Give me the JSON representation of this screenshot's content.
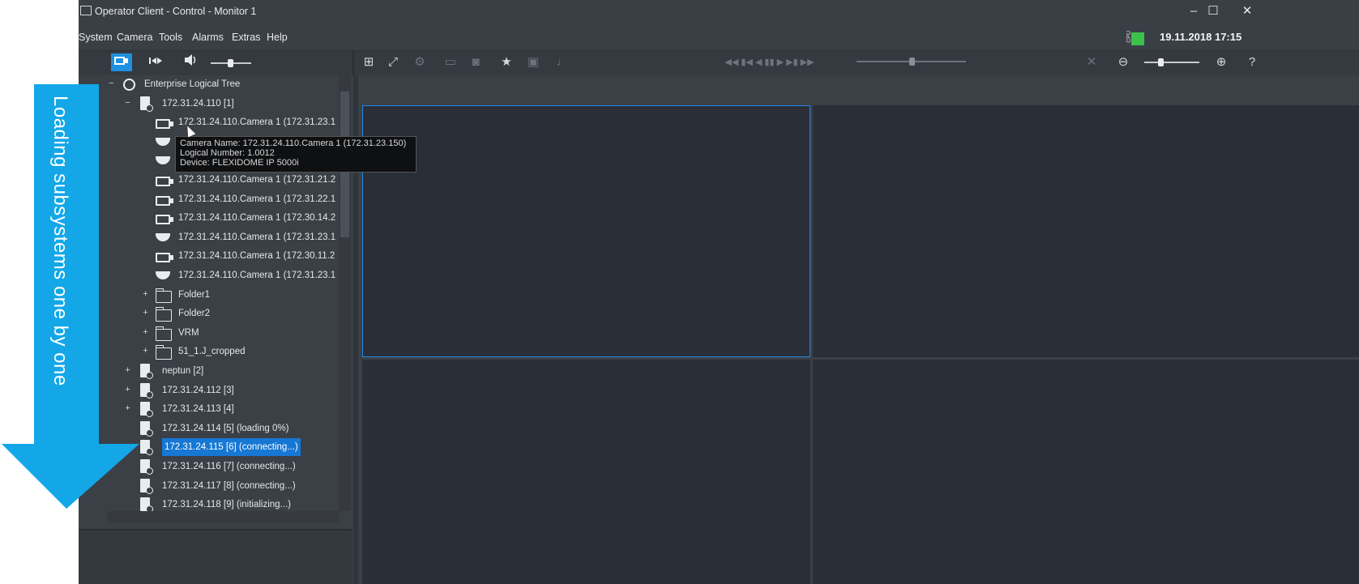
{
  "window": {
    "title": "Operator Client - Control - Monitor 1",
    "min": "–",
    "max": "☐",
    "close": "✕"
  },
  "menu": [
    "System",
    "Camera",
    "Tools",
    "Alarms",
    "Extras",
    "Help"
  ],
  "status": {
    "cpu_label": "CPU",
    "datetime": "19.11.2018 17:15"
  },
  "toolbar": {
    "help": "?"
  },
  "tree": {
    "root": "Enterprise Logical Tree",
    "items": [
      {
        "label": "172.31.24.110 [1]"
      },
      {
        "label": "172.31.24.110.Camera 1 (172.31.23.1"
      },
      {
        "label": ""
      },
      {
        "label": ""
      },
      {
        "label": "172.31.24.110.Camera 1 (172.31.21.2"
      },
      {
        "label": "172.31.24.110.Camera 1 (172.31.22.1"
      },
      {
        "label": "172.31.24.110.Camera 1 (172.30.14.2"
      },
      {
        "label": "172.31.24.110.Camera 1 (172.31.23.1"
      },
      {
        "label": "172.31.24.110.Camera 1 (172.30.11.2"
      },
      {
        "label": "172.31.24.110.Camera 1 (172.31.23.1"
      },
      {
        "label": "Folder1"
      },
      {
        "label": "Folder2"
      },
      {
        "label": "VRM"
      },
      {
        "label": "51_1.J_cropped"
      },
      {
        "label": "neptun [2]"
      },
      {
        "label": "172.31.24.112 [3]"
      },
      {
        "label": "172.31.24.113 [4]"
      },
      {
        "label": "172.31.24.114 [5] (loading 0%)"
      },
      {
        "label": "172.31.24.115 [6] (connecting...)"
      },
      {
        "label": "172.31.24.116 [7] (connecting...)"
      },
      {
        "label": "172.31.24.117 [8] (connecting...)"
      },
      {
        "label": "172.31.24.118 [9] (initializing...)"
      }
    ]
  },
  "tooltip": {
    "line1": "Camera  Name:  172.31.24.110.Camera  1  (172.31.23.150)",
    "line2": "Logical Number: 1.0012",
    "line3": "Device: FLEXIDOME IP 5000i"
  },
  "annotation": {
    "text": "Loading  subsystems one by one",
    "color": "#13a7e8"
  },
  "colors": {
    "accent": "#1f8fe0",
    "selection": "#1677d4",
    "cpu": "#3cc24a"
  }
}
